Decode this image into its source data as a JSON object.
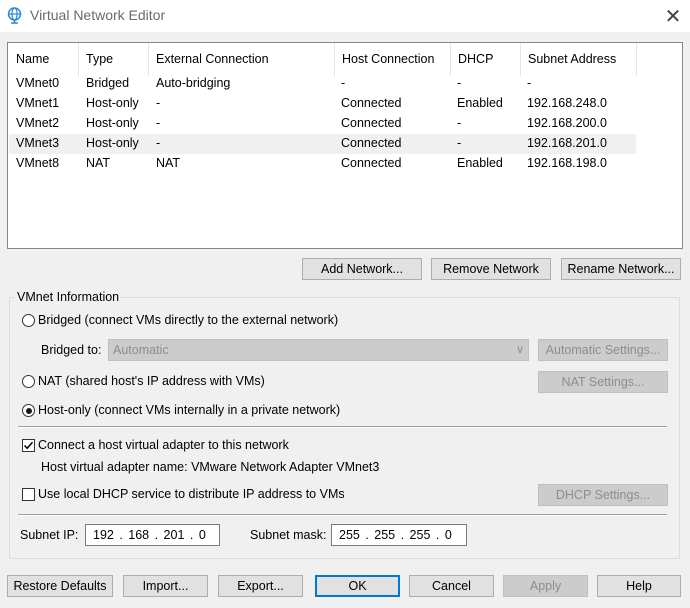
{
  "window": {
    "title": "Virtual Network Editor",
    "close_glyph": "✕"
  },
  "network_list": {
    "columns": [
      "Name",
      "Type",
      "External Connection",
      "Host Connection",
      "DHCP",
      "Subnet Address"
    ],
    "rows": [
      {
        "name": "VMnet0",
        "type": "Bridged",
        "external": "Auto-bridging",
        "host": "-",
        "dhcp": "-",
        "subnet": "-"
      },
      {
        "name": "VMnet1",
        "type": "Host-only",
        "external": "-",
        "host": "Connected",
        "dhcp": "Enabled",
        "subnet": "192.168.248.0"
      },
      {
        "name": "VMnet2",
        "type": "Host-only",
        "external": "-",
        "host": "Connected",
        "dhcp": "-",
        "subnet": "192.168.200.0"
      },
      {
        "name": "VMnet3",
        "type": "Host-only",
        "external": "-",
        "host": "Connected",
        "dhcp": "-",
        "subnet": "192.168.201.0"
      },
      {
        "name": "VMnet8",
        "type": "NAT",
        "external": "NAT",
        "host": "Connected",
        "dhcp": "Enabled",
        "subnet": "192.168.198.0"
      }
    ],
    "selected_row": 3
  },
  "list_buttons": {
    "add": "Add Network...",
    "remove": "Remove Network",
    "rename": "Rename Network..."
  },
  "vmnet_info": {
    "group_label": "VMnet Information",
    "bridged_label": "Bridged (connect VMs directly to the external network)",
    "bridged_to_label": "Bridged to:",
    "bridged_to_value": "Automatic",
    "auto_settings": "Automatic Settings...",
    "nat_label": "NAT (shared host's IP address with VMs)",
    "nat_settings": "NAT Settings...",
    "hostonly_label": "Host-only (connect VMs internally in a private network)",
    "selected_mode": "host-only",
    "connect_adapter_label": "Connect a host virtual adapter to this network",
    "connect_adapter_checked": true,
    "adapter_name_label": "Host virtual adapter name: VMware Network Adapter VMnet3",
    "dhcp_label": "Use local DHCP service to distribute IP address to VMs",
    "dhcp_checked": false,
    "dhcp_settings": "DHCP Settings...",
    "subnet_ip_label": "Subnet IP:",
    "subnet_ip_value": "192 . 168 . 201 .  0",
    "subnet_mask_label": "Subnet mask:",
    "subnet_mask_value": "255 . 255 . 255 .  0"
  },
  "footer_buttons": {
    "restore": "Restore Defaults",
    "import": "Import...",
    "export": "Export...",
    "ok": "OK",
    "cancel": "Cancel",
    "apply": "Apply",
    "help": "Help"
  },
  "colors": {
    "accent": "#0078d7",
    "title_icon": "#2b88d8",
    "selected_row": "#f0f0f0"
  }
}
